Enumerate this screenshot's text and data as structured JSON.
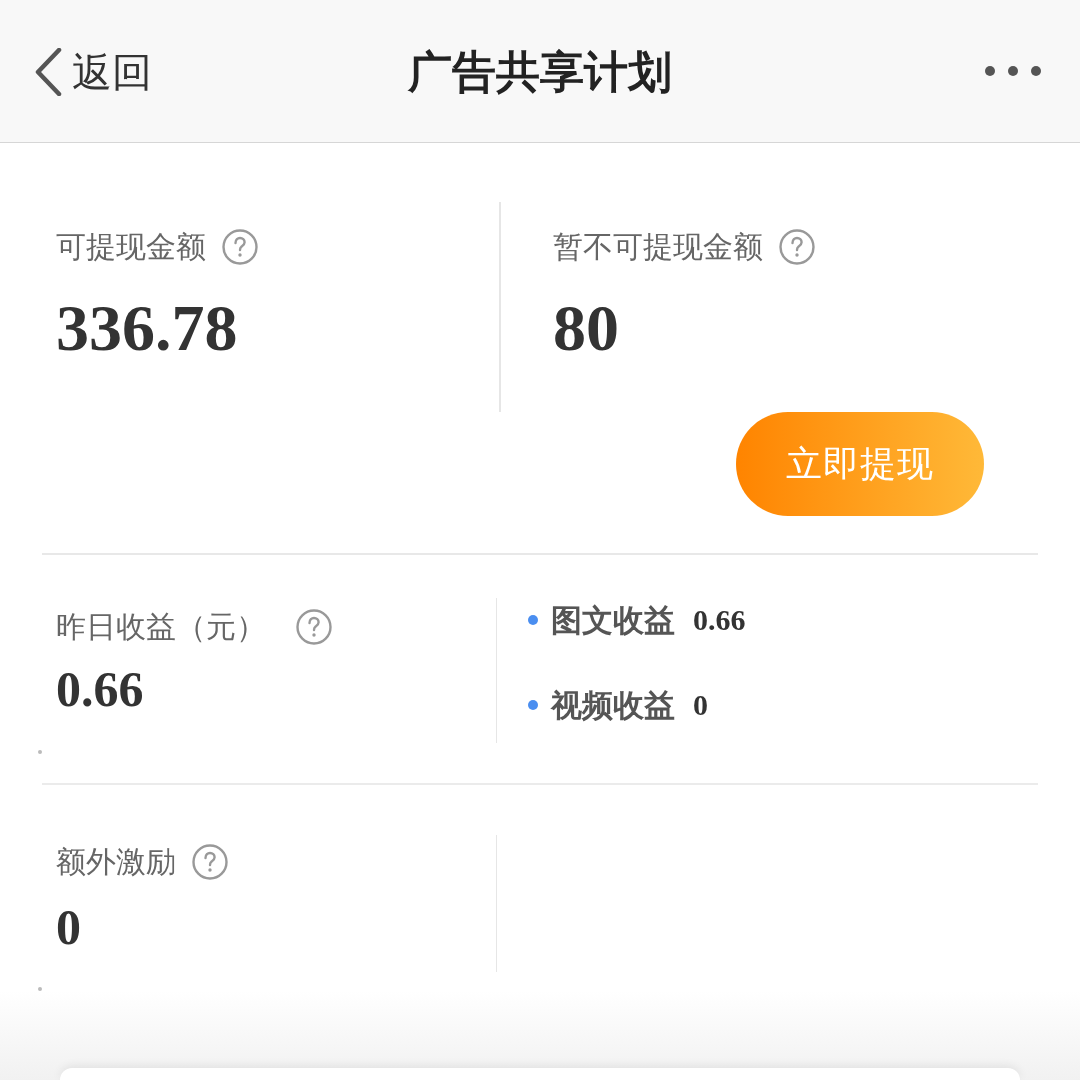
{
  "header": {
    "back_label": "返回",
    "title": "广告共享计划"
  },
  "balances": [
    {
      "label": "可提现金额",
      "value": "336.78"
    },
    {
      "label": "暂不可提现金额",
      "value": "80"
    }
  ],
  "withdraw_button": {
    "label": "立即提现"
  },
  "yesterday": {
    "label": "昨日收益（元）",
    "value": "0.66",
    "breakdown": [
      {
        "label": "图文收益",
        "value": "0.66"
      },
      {
        "label": "视频收益",
        "value": "0"
      }
    ]
  },
  "bonus": {
    "label": "额外激励",
    "value": "0"
  }
}
